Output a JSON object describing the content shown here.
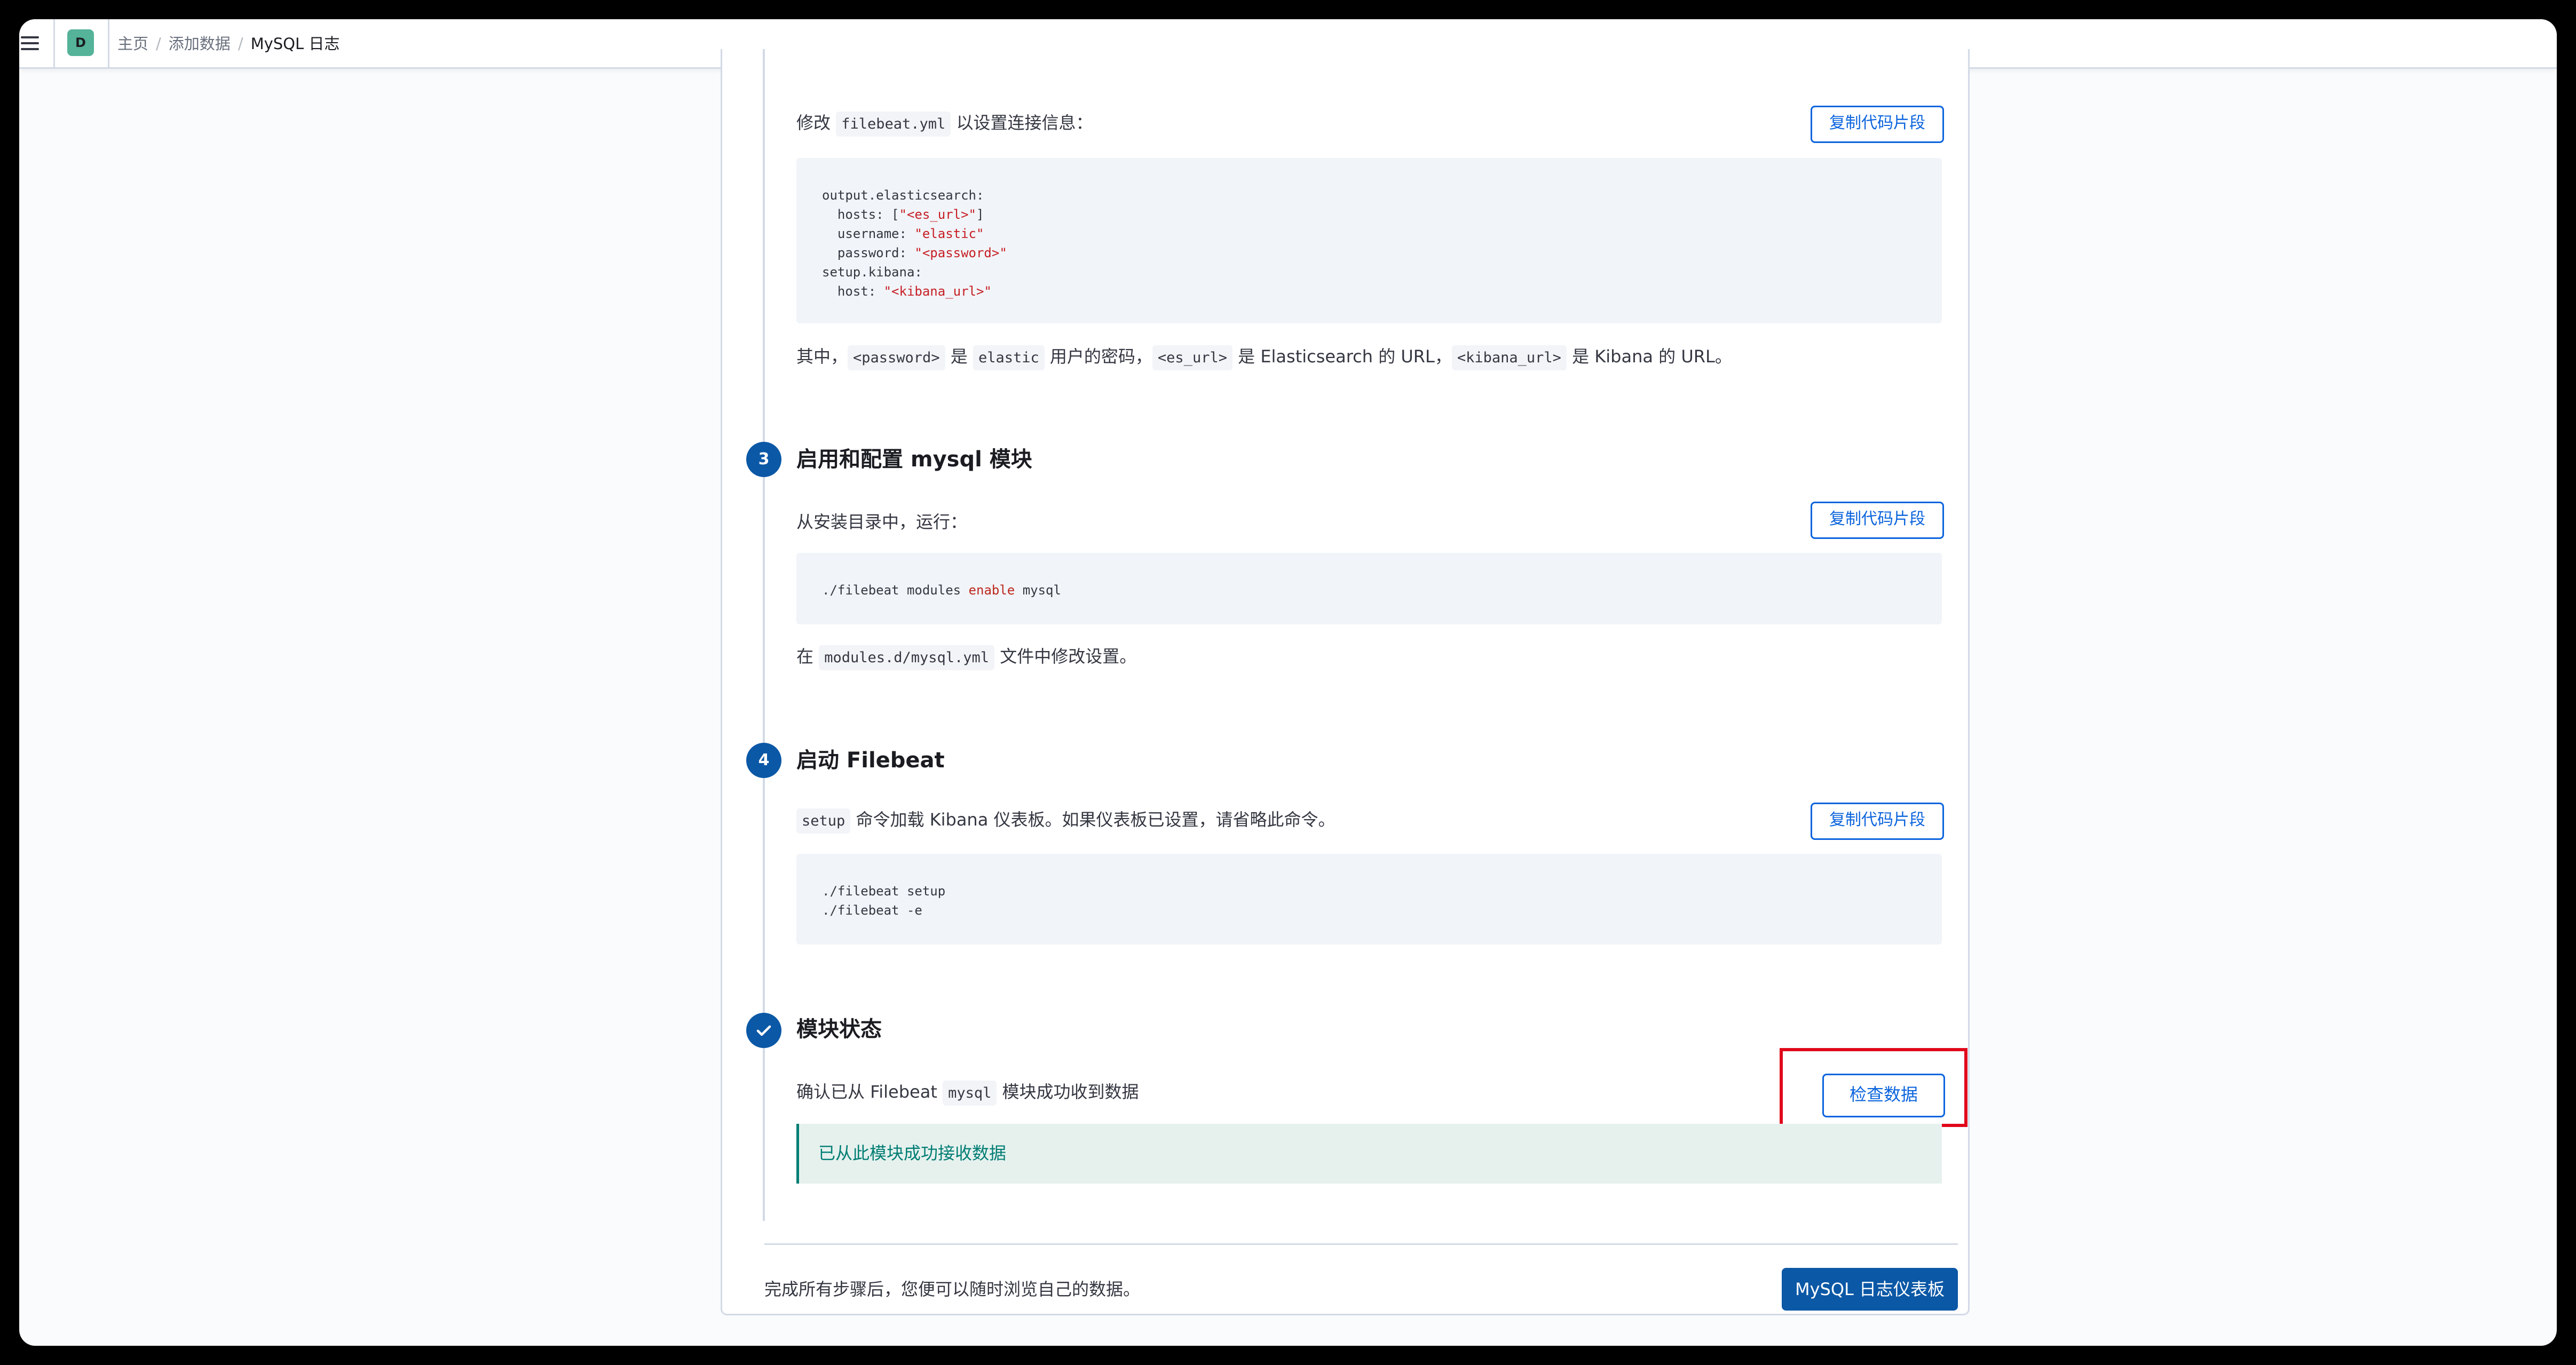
{
  "header": {
    "space_initial": "D",
    "breadcrumb": {
      "home": "主页",
      "separator": "/",
      "add_data": "添加数据",
      "current": "MySQL 日志"
    }
  },
  "step2": {
    "prefix": "修改",
    "file": "filebeat.yml",
    "suffix": "以设置连接信息：",
    "copy_label": "复制代码片段",
    "code": {
      "l1": "output.elasticsearch:",
      "l2_key": "  hosts: [",
      "l2_val": "\"<es_url>\"",
      "l2_end": "]",
      "l3_key": "  username: ",
      "l3_val": "\"elastic\"",
      "l4_key": "  password: ",
      "l4_val": "\"<password>\"",
      "l5": "setup.kibana:",
      "l6_key": "  host: ",
      "l6_val": "\"<kibana_url>\""
    },
    "note": {
      "p1": "其中，",
      "c1": "<password>",
      "p2": " 是 ",
      "c2": "elastic",
      "p3": " 用户的密码，",
      "c3": "<es_url>",
      "p4": " 是 Elasticsearch 的 URL，",
      "c4": "<kibana_url>",
      "p5": " 是 Kibana 的 URL。"
    }
  },
  "step3": {
    "number": "3",
    "title": "启用和配置 mysql 模块",
    "instruction": "从安装目录中，运行：",
    "copy_label": "复制代码片段",
    "code": {
      "pre": "./filebeat modules ",
      "kw": "enable",
      "post": " mysql"
    },
    "note": {
      "prefix": "在",
      "file": "modules.d/mysql.yml",
      "suffix": "文件中修改设置。"
    }
  },
  "step4": {
    "number": "4",
    "title": "启动 Filebeat",
    "cmd": "setup",
    "instruction": " 命令加载 Kibana 仪表板。如果仪表板已设置，请省略此命令。",
    "copy_label": "复制代码片段",
    "code": {
      "l1": "./filebeat setup",
      "l2": "./filebeat -e"
    }
  },
  "status": {
    "title": "模块状态",
    "prefix": "确认已从 Filebeat",
    "module": "mysql",
    "suffix": "模块成功收到数据",
    "check_button": "检查数据",
    "success_message": "已从此模块成功接收数据"
  },
  "footer": {
    "text": "完成所有步骤后，您便可以随时浏览自己的数据。",
    "dashboard_button": "MySQL 日志仪表板"
  },
  "colors": {
    "primary": "#0b58a6",
    "link": "#0b64dd",
    "success": "#017d73",
    "highlight": "#e0071b"
  }
}
